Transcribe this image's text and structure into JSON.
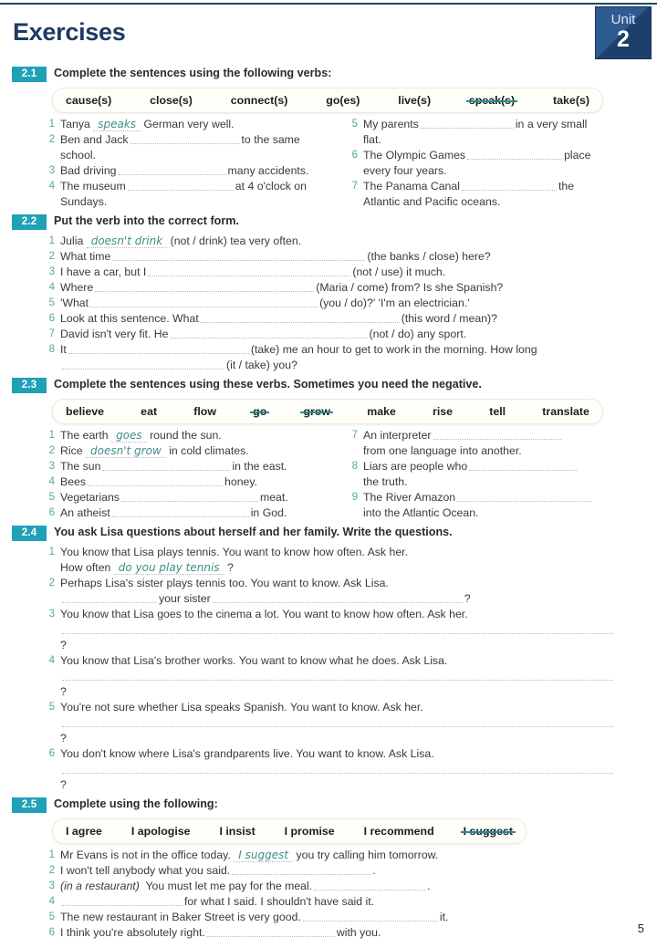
{
  "page": {
    "title": "Exercises",
    "unit_label": "Unit",
    "unit_number": "2",
    "page_number": "5",
    "accent_teal": "#20a1b8",
    "title_navy": "#1f3a63",
    "answer_green": "#3d8f86",
    "item_number_color": "#4fa8a0"
  },
  "exercises": [
    {
      "id": "2.1",
      "instruction": "Complete the sentences using the following verbs:",
      "wordbank": [
        {
          "word": "cause(s)",
          "struck": false
        },
        {
          "word": "close(s)",
          "struck": false
        },
        {
          "word": "connect(s)",
          "struck": false
        },
        {
          "word": "go(es)",
          "struck": false
        },
        {
          "word": "live(s)",
          "struck": false
        },
        {
          "word": "speak(s)",
          "struck": true
        },
        {
          "word": "take(s)",
          "struck": false
        }
      ],
      "left_items": [
        {
          "n": "1",
          "pre": "Tanya",
          "answer": "speaks",
          "post": "German very well.",
          "tail": ""
        },
        {
          "n": "2",
          "pre": "Ben and Jack",
          "answer": "",
          "post": "to the same",
          "tail": "school."
        },
        {
          "n": "3",
          "pre": "Bad driving",
          "answer": "",
          "post": "many accidents.",
          "tail": ""
        },
        {
          "n": "4",
          "pre": "The museum",
          "answer": "",
          "post": "at 4 o'clock on",
          "tail": "Sundays."
        }
      ],
      "right_items": [
        {
          "n": "5",
          "pre": "My parents",
          "answer": "",
          "post": "in a very small",
          "tail": "flat."
        },
        {
          "n": "6",
          "pre": "The Olympic Games",
          "answer": "",
          "post": "place",
          "tail": "every four years."
        },
        {
          "n": "7",
          "pre": "The Panama Canal",
          "answer": "",
          "post": "the",
          "tail": "Atlantic and Pacific oceans."
        }
      ]
    },
    {
      "id": "2.2",
      "instruction": "Put the verb into the correct form.",
      "items": [
        {
          "n": "1",
          "pre": "Julia",
          "answer": "doesn't drink",
          "post": "(not / drink) tea very often.",
          "tail": ""
        },
        {
          "n": "2",
          "pre": "What time",
          "answer": "",
          "post": "(the banks / close) here?",
          "tail": ""
        },
        {
          "n": "3",
          "pre": "I have a car, but I",
          "answer": "",
          "post": "(not / use) it much.",
          "tail": ""
        },
        {
          "n": "4",
          "pre": "Where",
          "answer": "",
          "post": "(Maria / come) from?  Is she Spanish?",
          "tail": ""
        },
        {
          "n": "5",
          "pre": "'What",
          "answer": "",
          "post": "(you / do)?'   'I'm an electrician.'",
          "tail": ""
        },
        {
          "n": "6",
          "pre": "Look at this sentence. What",
          "answer": "",
          "post": "(this word / mean)?",
          "tail": ""
        },
        {
          "n": "7",
          "pre": "David isn't very fit.  He",
          "answer": "",
          "post": "(not / do) any sport.",
          "tail": ""
        },
        {
          "n": "8",
          "pre": "It",
          "answer": "",
          "post": "(take) me an hour to get to work in the morning.  How long",
          "tail": "(it / take) you?"
        }
      ]
    },
    {
      "id": "2.3",
      "instruction": "Complete the sentences using these verbs.  Sometimes you need the negative.",
      "wordbank": [
        {
          "word": "believe",
          "struck": false
        },
        {
          "word": "eat",
          "struck": false
        },
        {
          "word": "flow",
          "struck": false
        },
        {
          "word": "go",
          "struck": true
        },
        {
          "word": "grow",
          "struck": true
        },
        {
          "word": "make",
          "struck": false
        },
        {
          "word": "rise",
          "struck": false
        },
        {
          "word": "tell",
          "struck": false
        },
        {
          "word": "translate",
          "struck": false
        }
      ],
      "left_items": [
        {
          "n": "1",
          "pre": "The earth",
          "answer": "goes",
          "post": "round the sun.",
          "tail": ""
        },
        {
          "n": "2",
          "pre": "Rice",
          "answer": "doesn't grow",
          "post": "in cold climates.",
          "tail": ""
        },
        {
          "n": "3",
          "pre": "The sun",
          "answer": "",
          "post": "in the east.",
          "tail": ""
        },
        {
          "n": "4",
          "pre": "Bees",
          "answer": "",
          "post": "honey.",
          "tail": ""
        },
        {
          "n": "5",
          "pre": "Vegetarians",
          "answer": "",
          "post": "meat.",
          "tail": ""
        },
        {
          "n": "6",
          "pre": "An atheist",
          "answer": "",
          "post": "in God.",
          "tail": ""
        }
      ],
      "right_items": [
        {
          "n": "7",
          "pre": "An interpreter",
          "answer": "",
          "post": "",
          "tail": "from one language into another."
        },
        {
          "n": "8",
          "pre": "Liars are people who",
          "answer": "",
          "post": "",
          "tail": "the truth."
        },
        {
          "n": "9",
          "pre": "The River Amazon",
          "answer": "",
          "post": "",
          "tail": "into the Atlantic Ocean."
        }
      ]
    },
    {
      "id": "2.4",
      "instruction": "You ask Lisa questions about herself and her family.  Write the questions.",
      "items": [
        {
          "n": "1",
          "prompt": "You know that Lisa plays tennis.  You want to know how often.  Ask her.",
          "answer_pre": "How often",
          "answer": "do you play tennis",
          "answer_post": "?",
          "blank_line": false
        },
        {
          "n": "2",
          "prompt": "Perhaps Lisa's sister plays tennis too.  You want to know.  Ask Lisa.",
          "answer_pre": "",
          "answer": "",
          "mid_text": "your sister",
          "answer_post": "?",
          "blank_line": true
        },
        {
          "n": "3",
          "prompt": "You know that Lisa goes to the cinema a lot.  You want to know how often.  Ask her.",
          "answer_pre": "",
          "answer": "",
          "answer_post": "?",
          "blank_line": true
        },
        {
          "n": "4",
          "prompt": "You know that Lisa's brother works.  You want to know what he does.  Ask Lisa.",
          "answer_pre": "",
          "answer": "",
          "answer_post": "?",
          "blank_line": true
        },
        {
          "n": "5",
          "prompt": "You're not sure whether Lisa speaks Spanish.  You want to know.  Ask her.",
          "answer_pre": "",
          "answer": "",
          "answer_post": "?",
          "blank_line": true
        },
        {
          "n": "6",
          "prompt": "You don't know where Lisa's grandparents live.  You want to know.  Ask Lisa.",
          "answer_pre": "",
          "answer": "",
          "answer_post": "?",
          "blank_line": true
        }
      ]
    },
    {
      "id": "2.5",
      "instruction": "Complete using the following:",
      "wordbank": [
        {
          "word": "I agree",
          "struck": false
        },
        {
          "word": "I apologise",
          "struck": false
        },
        {
          "word": "I insist",
          "struck": false
        },
        {
          "word": "I promise",
          "struck": false
        },
        {
          "word": "I recommend",
          "struck": false
        },
        {
          "word": "I suggest",
          "struck": true
        }
      ],
      "items": [
        {
          "n": "1",
          "pre": "Mr Evans is not in the office today.",
          "answer": "I suggest",
          "post": "you try calling him tomorrow.",
          "italic_pre": ""
        },
        {
          "n": "2",
          "pre": "I won't tell anybody what you said.",
          "answer": "",
          "post": ".",
          "italic_pre": ""
        },
        {
          "n": "3",
          "pre": "You must let me pay for the meal.",
          "answer": "",
          "post": ".",
          "italic_pre": "(in a restaurant)"
        },
        {
          "n": "4",
          "pre": "",
          "answer": "",
          "post": "for what I said.  I shouldn't have said it.",
          "italic_pre": ""
        },
        {
          "n": "5",
          "pre": "The new restaurant in Baker Street is very good.",
          "answer": "",
          "post": "it.",
          "italic_pre": ""
        },
        {
          "n": "6",
          "pre": "I think you're absolutely right.",
          "answer": "",
          "post": "with you.",
          "italic_pre": ""
        }
      ]
    }
  ]
}
